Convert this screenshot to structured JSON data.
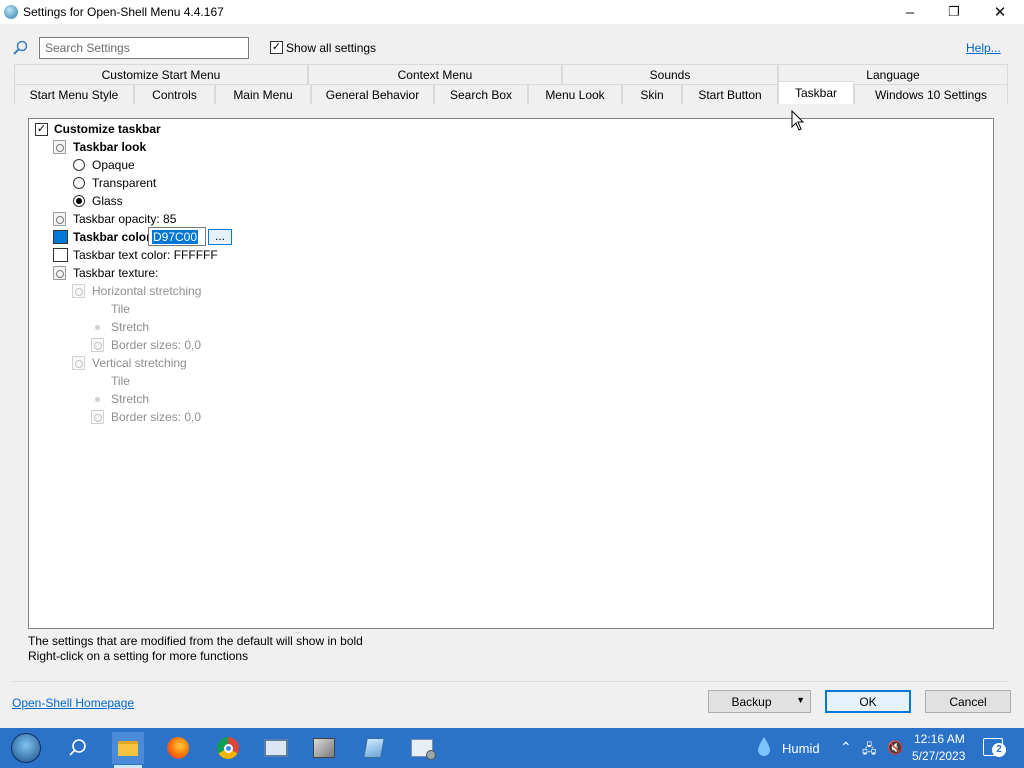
{
  "window": {
    "title": "Settings for Open-Shell Menu 4.4.167"
  },
  "search": {
    "placeholder": "Search Settings",
    "show_all_label": "Show all settings",
    "help_label": "Help..."
  },
  "tabs_row1": [
    "Customize Start Menu",
    "Context Menu",
    "Sounds",
    "Language"
  ],
  "tabs_row2": [
    "Start Menu Style",
    "Controls",
    "Main Menu",
    "General Behavior",
    "Search Box",
    "Menu Look",
    "Skin",
    "Start Button",
    "Taskbar",
    "Windows 10 Settings"
  ],
  "active_tab": "Taskbar",
  "settings": {
    "customize_taskbar": "Customize taskbar",
    "taskbar_look": "Taskbar look",
    "opaque": "Opaque",
    "transparent": "Transparent",
    "glass": "Glass",
    "opacity": "Taskbar opacity: 85",
    "color_label": "Taskbar color",
    "color_value": "D97C00",
    "browse": "...",
    "text_color": "Taskbar text color: FFFFFF",
    "texture": "Taskbar texture:",
    "h_stretch": "Horizontal stretching",
    "tile1": "Tile",
    "stretch1": "Stretch",
    "border1": "Border sizes: 0,0",
    "v_stretch": "Vertical stretching",
    "tile2": "Tile",
    "stretch2": "Stretch",
    "border2": "Border sizes: 0,0"
  },
  "colors": {
    "taskbar_color_swatch": "#0078d7",
    "text_color_swatch": "#ffffff"
  },
  "notes": {
    "line1": "The settings that are modified from the default will show in bold",
    "line2": "Right-click on a setting for more functions"
  },
  "footer": {
    "homepage": "Open-Shell Homepage",
    "backup": "Backup",
    "ok": "OK",
    "cancel": "Cancel"
  },
  "taskbar": {
    "weather": "Humid",
    "time": "12:16 AM",
    "date": "5/27/2023",
    "notification_count": "2"
  }
}
